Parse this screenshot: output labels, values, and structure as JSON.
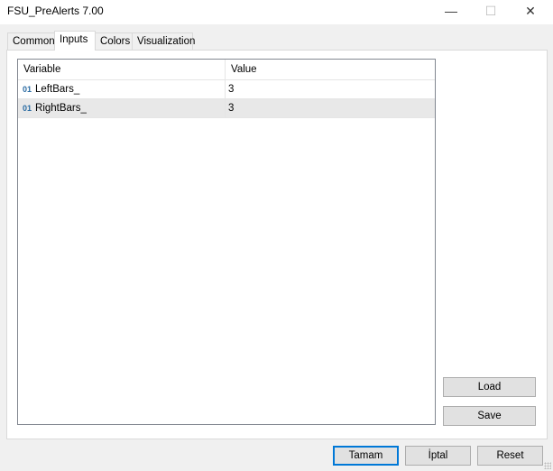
{
  "window": {
    "title": "FSU_PreAlerts 7.00",
    "controls": {
      "minimize": "—",
      "maximize": "☐",
      "close": "✕"
    }
  },
  "tabs": [
    {
      "label": "Common"
    },
    {
      "label": "Inputs",
      "active": true
    },
    {
      "label": "Colors"
    },
    {
      "label": "Visualization"
    }
  ],
  "grid": {
    "columns": [
      "Variable",
      "Value"
    ],
    "rows": [
      {
        "type_icon": "01",
        "variable": "LeftBars_",
        "value": "3",
        "selected": false
      },
      {
        "type_icon": "01",
        "variable": "RightBars_",
        "value": "3",
        "selected": true
      }
    ]
  },
  "side_buttons": {
    "load": "Load",
    "save": "Save"
  },
  "footer": {
    "ok": "Tamam",
    "cancel": "İptal",
    "reset": "Reset"
  },
  "colors": {
    "accent": "#0078d7",
    "selected_row": "#e8e8e8"
  }
}
